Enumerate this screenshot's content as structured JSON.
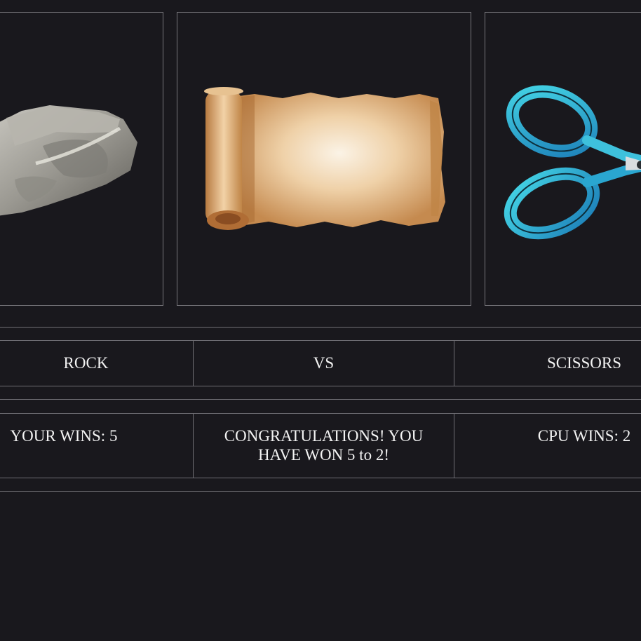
{
  "choices": {
    "left": {
      "name": "rock",
      "image": "rock-image"
    },
    "middle": {
      "name": "paper",
      "image": "paper-scroll-image"
    },
    "right": {
      "name": "scissors",
      "image": "scissors-image"
    }
  },
  "matchup": {
    "player_choice": "ROCK",
    "versus": "VS",
    "cpu_choice": "SCISSORS"
  },
  "score": {
    "your_wins": "YOUR WINS: 5",
    "result_message": "CONGRATULATIONS! YOU HAVE WON 5 to 2!",
    "cpu_wins": "CPU WINS: 2"
  },
  "colors": {
    "background": "#19181d",
    "border": "#77767b",
    "text": "#f3f3f3"
  }
}
